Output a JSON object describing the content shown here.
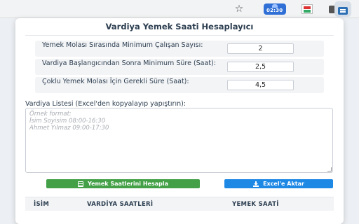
{
  "browser": {
    "extension_clock_text": "02:30",
    "icons": [
      "star-icon",
      "clock-extension-icon",
      "extension-icon",
      "puzzle-icon",
      "active-extension-icon"
    ]
  },
  "popup": {
    "title": "Vardiya Yemek Saati Hesaplayıcı",
    "params": [
      {
        "label": "Yemek Molası Sırasında Minimum Çalışan Sayısı:",
        "value": "2"
      },
      {
        "label": "Vardiya Başlangıcından Sonra Minimum Süre (Saat):",
        "value": "2,5"
      },
      {
        "label": "Çoklu Yemek Molası İçin Gerekli Süre (Saat):",
        "value": "4,5"
      }
    ],
    "list_label": "Vardiya Listesi (Excel'den kopyalayıp yapıştırın):",
    "placeholder_lines": [
      "Örnek format:",
      "İsim Soyisim 08:00-16:30",
      "Ahmet Yılmaz 09:00-17:30"
    ],
    "calc_button": "Yemek Saatlerini Hesapla",
    "export_button": "Excel'e Aktar",
    "table_headers": [
      "İSİM",
      "VARDİYA SAATLERİ",
      "YEMEK SAATİ"
    ]
  },
  "colors": {
    "calc_button": "#43a047",
    "export_button": "#1e88e5",
    "title": "#2c3e50"
  }
}
